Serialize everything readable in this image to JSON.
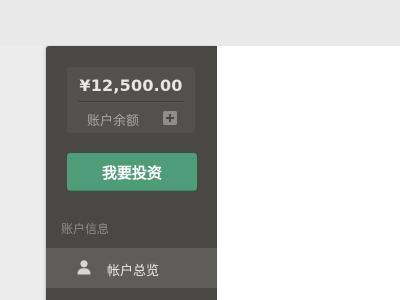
{
  "sidebar": {
    "balance": {
      "amount": "¥12,500.00",
      "label": "账户余额"
    },
    "invest_button": "我要投资",
    "section_title": "账户信息",
    "nav_items": [
      {
        "label": "帐户总览",
        "icon": "user-icon"
      }
    ]
  },
  "colors": {
    "sidebar_bg": "#4a4845",
    "accent_green": "#4f9c79",
    "active_item_bg": "#5f5d59"
  }
}
